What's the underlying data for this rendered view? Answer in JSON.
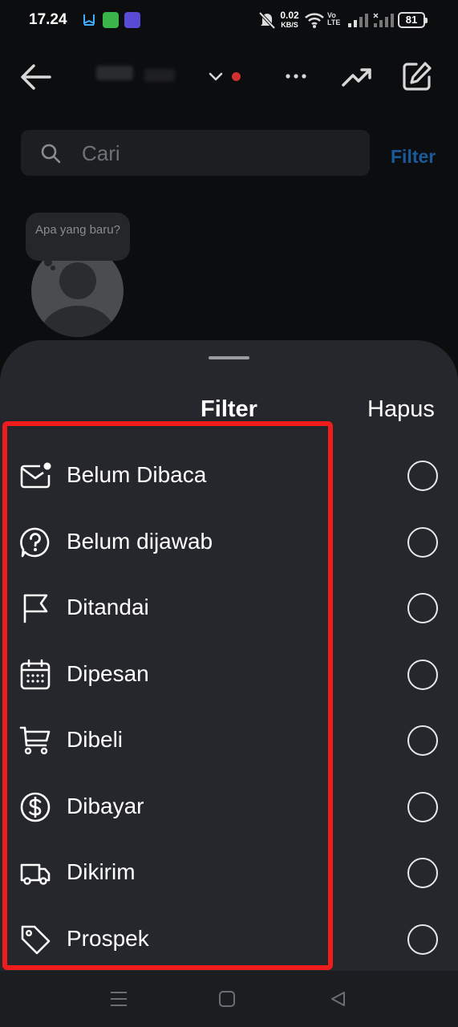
{
  "status_bar": {
    "time": "17.24",
    "net_speed_value": "0.02",
    "net_speed_unit": "KB/S",
    "volte": "Vo LTE",
    "battery": "81"
  },
  "header": {
    "icons": [
      "back-arrow-icon",
      "chevron-down-icon",
      "more-icon",
      "trending-icon",
      "edit-icon"
    ],
    "notification_dot_color": "#d32f2f"
  },
  "search": {
    "placeholder": "Cari",
    "filter_label": "Filter"
  },
  "note": {
    "text": "Apa yang baru?"
  },
  "sheet": {
    "title": "Filter",
    "clear_label": "Hapus",
    "highlight_color": "#ee1c1c",
    "options": [
      {
        "label": "Belum Dibaca",
        "icon": "unread-mail-icon",
        "selected": false
      },
      {
        "label": "Belum dijawab",
        "icon": "question-bubble-icon",
        "selected": false
      },
      {
        "label": "Ditandai",
        "icon": "flag-icon",
        "selected": false
      },
      {
        "label": "Dipesan",
        "icon": "calendar-icon",
        "selected": false
      },
      {
        "label": "Dibeli",
        "icon": "cart-icon",
        "selected": false
      },
      {
        "label": "Dibayar",
        "icon": "dollar-icon",
        "selected": false
      },
      {
        "label": "Dikirim",
        "icon": "truck-icon",
        "selected": false
      },
      {
        "label": "Prospek",
        "icon": "tag-icon",
        "selected": false
      }
    ]
  },
  "nav_bar": {
    "icons": [
      "recent-apps-icon",
      "home-icon",
      "back-triangle-icon"
    ]
  }
}
